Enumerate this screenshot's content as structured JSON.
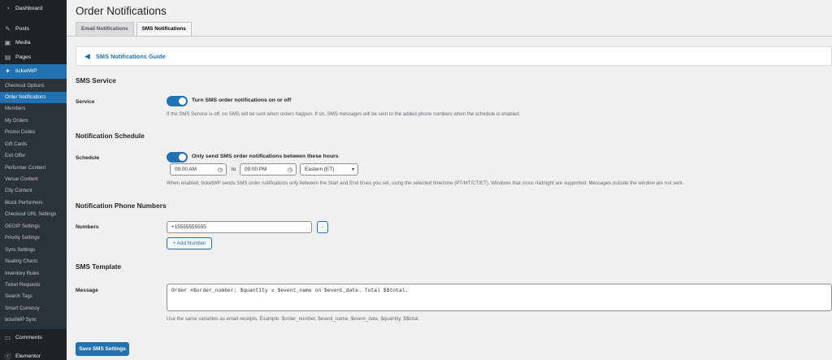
{
  "sidebar": {
    "top_items": [
      {
        "label": "Dashboard",
        "icon": "dashboard-icon"
      },
      {
        "label": "Posts",
        "icon": "pin-icon"
      },
      {
        "label": "Media",
        "icon": "media-icon"
      },
      {
        "label": "Pages",
        "icon": "pages-icon"
      },
      {
        "label": "ticketWP",
        "icon": "ticket-icon"
      }
    ],
    "submenu": [
      "Checkout Options",
      "Order Notifications",
      "Members",
      "My Orders",
      "Promo Codes",
      "Gift Cards",
      "Exit Offer",
      "Performer Content",
      "Venue Content",
      "City Content",
      "Block Performers",
      "Checkout URL Settings",
      "GEOIP Settings",
      "Priority Settings",
      "Sync Settings",
      "Seating Charts",
      "Inventory Rules",
      "Ticket Requests",
      "Search Tags",
      "Smart Currency",
      "ticketWP Sync"
    ],
    "bottom_items": [
      {
        "label": "Comments",
        "icon": "comments-icon"
      },
      {
        "label": "Elementor",
        "icon": "elementor-icon"
      }
    ]
  },
  "page": {
    "title": "Order Notifications",
    "tabs": [
      {
        "label": "Email Notifications"
      },
      {
        "label": "SMS Notifications"
      }
    ],
    "guide_title": "SMS Notifications Guide"
  },
  "sms_service": {
    "heading": "SMS Service",
    "label": "Service",
    "toggle_label": "Turn SMS order notifications on or off",
    "help": "If the SMS Service is off, no SMS will be sent when orders happen. If on, SMS messages will be sent to the added phone numbers when the schedule is enabled."
  },
  "schedule": {
    "heading": "Notification Schedule",
    "label": "Schedule",
    "toggle_label": "Only send SMS order notifications between these hours",
    "start_time": "09:00 AM",
    "to_label": "to",
    "end_time": "09:00 PM",
    "timezone": "Eastern (ET)",
    "help": "When enabled, ticketWP sends SMS order notifications only between the Start and End times you set, using the selected timezone (PT/MT/CT/ET). Windows that cross midnight are supported. Messages outside the window are not sent."
  },
  "numbers": {
    "heading": "Notification Phone Numbers",
    "label": "Numbers",
    "phone": "+15555555555",
    "remove_label": "-",
    "add_label": "+ Add Number"
  },
  "template": {
    "heading": "SMS Template",
    "label": "Message",
    "message": "Order #$order_number: $quantity x $event_name on $event_date. Total $$total.",
    "help": "Use the same variables as email receipts. Example: $order_number, $event_name, $event_date, $quantity, $$total."
  },
  "save_label": "Save SMS Settings"
}
